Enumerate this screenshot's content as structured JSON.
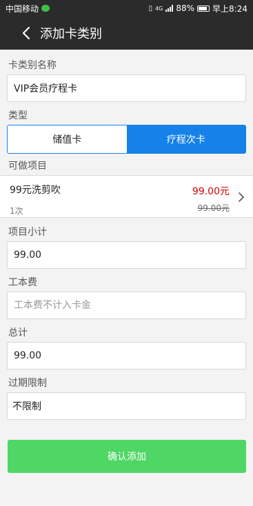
{
  "status_bar": {
    "carrier": "中国移动",
    "network": "4G",
    "battery_percent": "88%",
    "battery_level": 0.88,
    "time": "早上8:24"
  },
  "nav": {
    "title": "添加卡类别"
  },
  "card_name": {
    "label": "卡类别名称",
    "value": "VIP会员疗程卡"
  },
  "type": {
    "label": "类型",
    "options": [
      "储值卡",
      "疗程次卡"
    ],
    "selected": "疗程次卡"
  },
  "projects": {
    "label": "可做项目",
    "items": [
      {
        "name": "99元洗剪吹",
        "count": "1次",
        "price": "99.00元",
        "original_price": "99.00元"
      }
    ]
  },
  "subtotal": {
    "label": "项目小计",
    "value": "99.00"
  },
  "labor_fee": {
    "label": "工本费",
    "placeholder": "工本费不计入卡金"
  },
  "total": {
    "label": "总计",
    "value": "99.00"
  },
  "expiry": {
    "label": "过期限制",
    "value": "不限制"
  },
  "confirm_button": {
    "label": "确认添加"
  },
  "colors": {
    "accent_blue": "#1681e8",
    "confirm_green": "#4ed765",
    "price_red": "#d40000",
    "header_dark": "#2b2b2b"
  }
}
